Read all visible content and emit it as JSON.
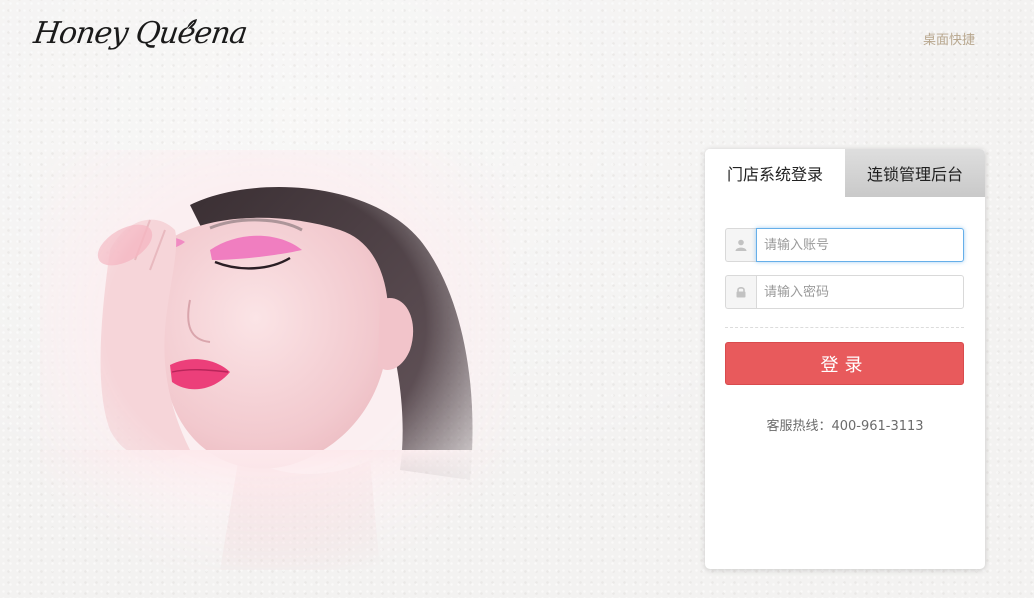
{
  "logo": {
    "text": "Honey Queena"
  },
  "header": {
    "shortcut_link": "桌面快捷"
  },
  "login": {
    "tabs": [
      {
        "label": "门店系统登录",
        "active": true
      },
      {
        "label": "连锁管理后台",
        "active": false
      }
    ],
    "username": {
      "placeholder": "请输入账号",
      "icon": "user-icon"
    },
    "password": {
      "placeholder": "请输入密码",
      "icon": "lock-icon"
    },
    "submit_label": "登录",
    "hotline_label": "客服热线：",
    "hotline_number": "400-961-3113"
  },
  "colors": {
    "accent": "#e85a5c",
    "link": "#b8a78e",
    "focus": "#66afe9"
  }
}
